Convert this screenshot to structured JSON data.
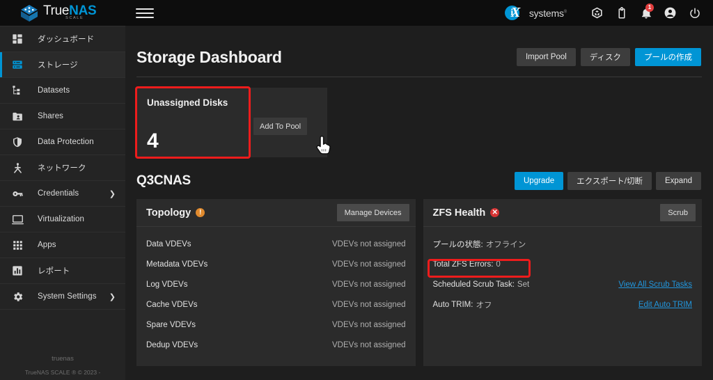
{
  "brand": {
    "true_text": "True",
    "nas_text": "NAS",
    "scale_text": "SCALE",
    "logo_icon": "truenas-cube-logo"
  },
  "topbar": {
    "menu_icon": "hamburger-menu-icon",
    "ix_letter_i": "i",
    "ix_letter_x": "X",
    "ix_word": "systems",
    "ix_tm": "®",
    "icons": [
      {
        "name": "ix-cube-icon",
        "label": "iX Cube"
      },
      {
        "name": "clipboard-icon",
        "label": "Jobs"
      },
      {
        "name": "bell-icon",
        "label": "Alerts",
        "badge": "1"
      },
      {
        "name": "account-icon",
        "label": "Account"
      },
      {
        "name": "power-icon",
        "label": "Power"
      }
    ]
  },
  "sidebar": {
    "items": [
      {
        "label": "ダッシュボード",
        "icon": "dashboard-icon",
        "active": false,
        "chevron": false
      },
      {
        "label": "ストレージ",
        "icon": "storage-icon",
        "active": true,
        "chevron": false
      },
      {
        "label": "Datasets",
        "icon": "datasets-tree-icon",
        "active": false,
        "chevron": false
      },
      {
        "label": "Shares",
        "icon": "shares-folder-icon",
        "active": false,
        "chevron": false
      },
      {
        "label": "Data Protection",
        "icon": "shield-icon",
        "active": false,
        "chevron": false
      },
      {
        "label": "ネットワーク",
        "icon": "network-icon",
        "active": false,
        "chevron": false
      },
      {
        "label": "Credentials",
        "icon": "key-icon",
        "active": false,
        "chevron": true
      },
      {
        "label": "Virtualization",
        "icon": "monitor-icon",
        "active": false,
        "chevron": false
      },
      {
        "label": "Apps",
        "icon": "apps-grid-icon",
        "active": false,
        "chevron": false
      },
      {
        "label": "レポート",
        "icon": "reports-chart-icon",
        "active": false,
        "chevron": false
      },
      {
        "label": "System Settings",
        "icon": "gear-icon",
        "active": false,
        "chevron": true
      }
    ],
    "footer_hostname": "truenas",
    "footer_copyright": "TrueNAS SCALE ® © 2023 -"
  },
  "page": {
    "title": "Storage Dashboard",
    "buttons": {
      "import_pool": "Import Pool",
      "disks": "ディスク",
      "create_pool": "プールの作成"
    }
  },
  "unassigned": {
    "title": "Unassigned Disks",
    "count": "4",
    "add_to_pool": "Add To Pool",
    "highlight_color": "#ee1c1c",
    "cursor_icon": "pointing-hand-cursor"
  },
  "pool": {
    "name": "Q3CNAS",
    "buttons": {
      "upgrade": "Upgrade",
      "export_disconnect": "エクスポート/切断",
      "expand": "Expand"
    }
  },
  "topology": {
    "title": "Topology",
    "status_icon": "warning-exclamation-icon",
    "status_color": "#e08a2e",
    "manage_button": "Manage Devices",
    "rows": [
      {
        "key": "Data VDEVs",
        "value": "VDEVs not assigned"
      },
      {
        "key": "Metadata VDEVs",
        "value": "VDEVs not assigned"
      },
      {
        "key": "Log VDEVs",
        "value": "VDEVs not assigned"
      },
      {
        "key": "Cache VDEVs",
        "value": "VDEVs not assigned"
      },
      {
        "key": "Spare VDEVs",
        "value": "VDEVs not assigned"
      },
      {
        "key": "Dedup VDEVs",
        "value": "VDEVs not assigned"
      }
    ]
  },
  "zfs_health": {
    "title": "ZFS Health",
    "status_icon": "error-cross-icon",
    "status_color": "#d63434",
    "scrub_button": "Scrub",
    "pool_status_key": "プールの状態:",
    "pool_status_value": "オフライン",
    "total_errors_key": "Total ZFS Errors:",
    "total_errors_value": "0",
    "scheduled_scrub_key": "Scheduled Scrub Task:",
    "scheduled_scrub_value": "Set",
    "scheduled_scrub_link": "View All Scrub Tasks",
    "auto_trim_key": "Auto TRIM:",
    "auto_trim_value": "オフ",
    "auto_trim_link": "Edit Auto TRIM",
    "highlight_color": "#ee1c1c"
  }
}
